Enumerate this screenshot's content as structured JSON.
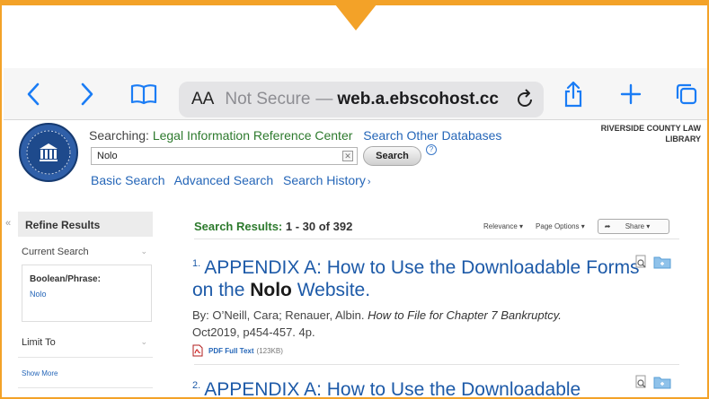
{
  "browser": {
    "text_size_label": "AA",
    "not_secure_label": "Not Secure",
    "separator": "—",
    "domain": "web.a.ebscohost.cc",
    "icons": [
      "chevron-left-icon",
      "chevron-right-icon",
      "bookmarks-icon",
      "reload-icon",
      "share-icon",
      "plus-icon",
      "tabs-icon"
    ]
  },
  "header": {
    "searching_label": "Searching:",
    "database": "Legal Information Reference Center",
    "search_other": "Search Other Databases",
    "search_value": "Nolo",
    "search_button": "Search",
    "help_symbol": "?",
    "clear_symbol": "✕",
    "library": "RIVERSIDE COUNTY LAW LIBRARY",
    "links": [
      "Basic Search",
      "Advanced Search",
      "Search History"
    ],
    "history_chevron": "›"
  },
  "sidebar": {
    "collapse": "«",
    "refine_title": "Refine Results",
    "current_search": "Current Search",
    "boolean_label": "Boolean/Phrase:",
    "boolean_value": "Nolo",
    "limit_to": "Limit To",
    "show_more": "Show More"
  },
  "results": {
    "label": "Search Results:",
    "range": "1 - 30 of 392",
    "sort": "Relevance ▾",
    "page_options": "Page Options ▾",
    "share": "Share ▾",
    "items": [
      {
        "number": "1.",
        "title_pre": "APPENDIX A: How to Use the Downloadable Forms on the ",
        "title_bold": "Nolo",
        "title_post": " Website.",
        "authors": "By: O’Neill, Cara; Renauer, Albin. ",
        "source": "How to File for Chapter 7 Bankruptcy.",
        "details": "Oct2019, p454-457. 4p.",
        "pdf_label": "PDF Full Text",
        "pdf_size": "(123KB)"
      },
      {
        "number": "2.",
        "title_pre": "APPENDIX A: How to Use the Downloadable"
      }
    ]
  },
  "colors": {
    "accent_orange": "#f3a228",
    "link_blue": "#2566b8",
    "title_blue": "#1d5aa8",
    "db_green": "#2d7a2d",
    "ios_blue": "#1a7cf5"
  }
}
